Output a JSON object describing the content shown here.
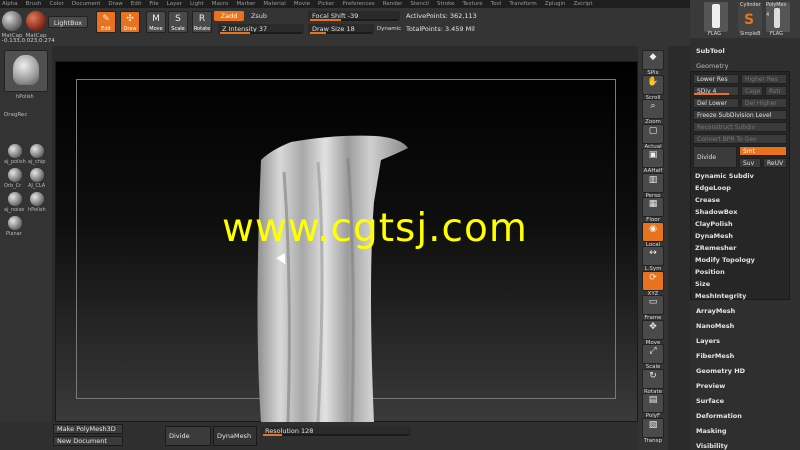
{
  "menubar": [
    "Alpha",
    "Brush",
    "Color",
    "Document",
    "Draw",
    "Edit",
    "File",
    "Layer",
    "Light",
    "Macro",
    "Marker",
    "Material",
    "Movie",
    "Picker",
    "Preferences",
    "Render",
    "Stencil",
    "Stroke",
    "Texture",
    "Tool",
    "Transform",
    "Zplugin",
    "Zscript"
  ],
  "toolbar": {
    "matcap1": "MatCap",
    "matcap2": "MatCap",
    "lightbox": "LightBox",
    "edit": "Edit",
    "draw": "Draw",
    "move": "Move",
    "scale": "Scale",
    "rotate": "Rotate",
    "zadd": "Zadd",
    "zsub": "Zsub",
    "z_intensity": "Z Intensity 37",
    "z_intensity_value": 0.37,
    "focal_shift": "Focal Shift -39",
    "draw_size": "Draw Size 18",
    "dynamic": "Dynamic",
    "active_points": "ActivePoints: 362,113",
    "total_points": "TotalPoints: 3.459 Mil"
  },
  "leftshelf": {
    "coords": "-0.133,0.023,0.274",
    "brush_label": "hPolish",
    "dragrec": "DragRec",
    "brushes": [
      "aj_polish",
      "aj_chip",
      "Orb_Cr",
      "AJ_CLA",
      "aj_noise",
      "hPolish",
      "Planar"
    ]
  },
  "canvas": {
    "watermark": "www.cgtsj.com"
  },
  "rightdock": [
    "SPix",
    "Scroll",
    "Zoom",
    "Actual",
    "AAHalf",
    "Persp",
    "Floor",
    "Local",
    "L.Sym",
    "XYZ",
    "Frame",
    "Move",
    "Scale",
    "Rotate",
    "PolyF",
    "Transp"
  ],
  "palette": {
    "tool1": "Cylinder",
    "tool2": "PolyMes",
    "tool3": "SimpleB",
    "tool4": "FLAG",
    "tool5": "FLAG",
    "tool_count": "4",
    "subtool": "SubTool",
    "geometry": "Geometry",
    "lower_res": "Lower Res",
    "higher_res": "Higher Res",
    "sdiv": "SDiv 4",
    "cage": "Cage",
    "rstr": "Rstr",
    "del_lower": "Del Lower",
    "del_higher": "Del Higher",
    "freeze": "Freeze SubDivision Level",
    "reconstruct": "Reconstruct Subdiv",
    "convert_bpr": "Convert BPR To Geo",
    "divide": "Divide",
    "smt": "Smt",
    "suv": "Suv",
    "reuv": "ReUV",
    "geo_items": [
      "Dynamic Subdiv",
      "EdgeLoop",
      "Crease",
      "ShadowBox",
      "ClayPolish",
      "DynaMesh",
      "ZRemesher",
      "Modify Topology",
      "Position",
      "Size",
      "MeshIntegrity"
    ],
    "sections": [
      "ArrayMesh",
      "NanoMesh",
      "Layers",
      "FiberMesh",
      "Geometry HD",
      "Preview",
      "Surface",
      "Deformation",
      "Masking",
      "Visibility"
    ]
  },
  "bottombar": {
    "make_polymesh": "Make PolyMesh3D",
    "new_document": "New Document",
    "divide": "Divide",
    "dynamesh": "DynaMesh",
    "resolution": "Resolution 128",
    "resolution_value": 0.128
  },
  "colors": {
    "accent": "#e8731c",
    "watermark": "#ffff00"
  }
}
